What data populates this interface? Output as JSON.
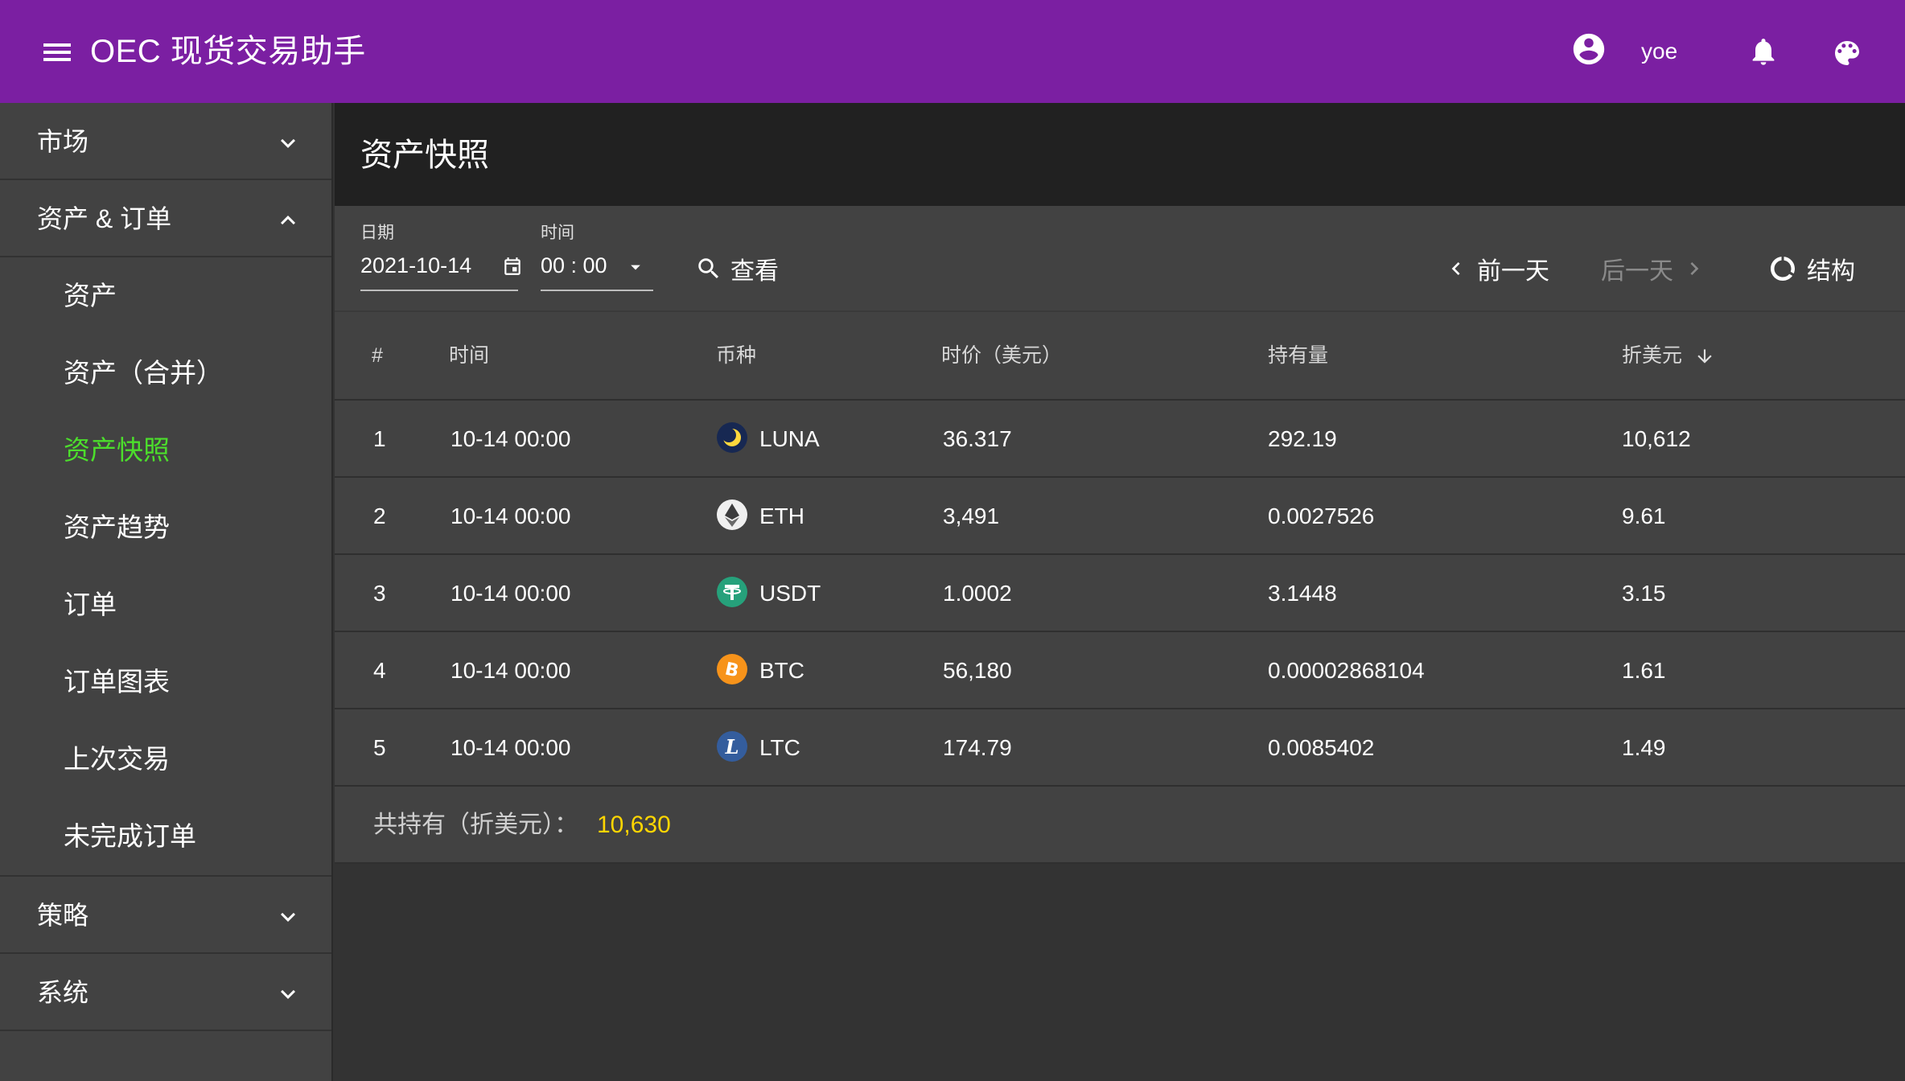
{
  "app": {
    "title": "OEC 现货交易助手",
    "user": "yoe",
    "accent_color": "#7b1fa2",
    "active_color": "#4cde2c",
    "total_color": "#ffd600"
  },
  "sidebar": {
    "groups": [
      {
        "label": "市场",
        "expanded": false
      },
      {
        "label": "资产 & 订单",
        "expanded": true
      },
      {
        "label": "策略",
        "expanded": false
      },
      {
        "label": "系统",
        "expanded": false
      }
    ],
    "sub_items": [
      {
        "label": "资产"
      },
      {
        "label": "资产（合并）"
      },
      {
        "label": "资产快照",
        "active": true
      },
      {
        "label": "资产趋势"
      },
      {
        "label": "订单"
      },
      {
        "label": "订单图表"
      },
      {
        "label": "上次交易"
      },
      {
        "label": "未完成订单"
      }
    ]
  },
  "page": {
    "title": "资产快照",
    "date_label": "日期",
    "date_value": "2021-10-14",
    "time_label": "时间",
    "time_value": "00 : 00",
    "view_btn": "查看",
    "prev_btn": "前一天",
    "next_btn": "后一天",
    "struct_btn": "结构"
  },
  "table": {
    "headers": [
      "#",
      "时间",
      "币种",
      "时价（美元）",
      "持有量",
      "折美元"
    ],
    "rows": [
      {
        "idx": "1",
        "time": "10-14 00:00",
        "coin": "LUNA",
        "icon": "luna-icon",
        "price": "36.317",
        "amount": "292.19",
        "usd": "10,612"
      },
      {
        "idx": "2",
        "time": "10-14 00:00",
        "coin": "ETH",
        "icon": "eth-icon",
        "price": "3,491",
        "amount": "0.0027526",
        "usd": "9.61"
      },
      {
        "idx": "3",
        "time": "10-14 00:00",
        "coin": "USDT",
        "icon": "usdt-icon",
        "price": "1.0002",
        "amount": "3.1448",
        "usd": "3.15"
      },
      {
        "idx": "4",
        "time": "10-14 00:00",
        "coin": "BTC",
        "icon": "btc-icon",
        "price": "56,180",
        "amount": "0.00002868104",
        "usd": "1.61"
      },
      {
        "idx": "5",
        "time": "10-14 00:00",
        "coin": "LTC",
        "icon": "ltc-icon",
        "price": "174.79",
        "amount": "0.0085402",
        "usd": "1.49"
      }
    ],
    "total_label": "共持有（折美元）：",
    "total_value": "10,630"
  }
}
